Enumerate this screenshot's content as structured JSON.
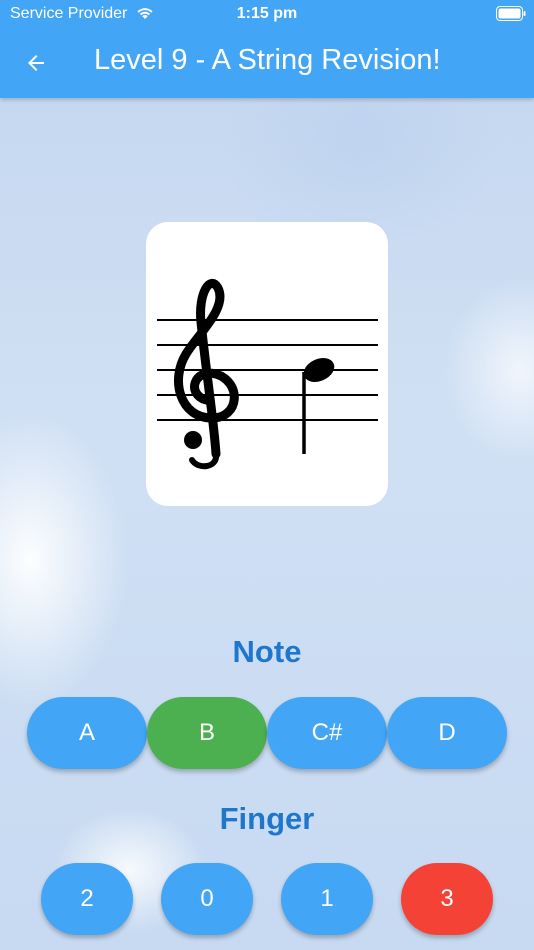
{
  "status_bar": {
    "carrier": "Service Provider",
    "time": "1:15 pm"
  },
  "header": {
    "title": "Level 9 - A String Revision!",
    "back_icon": "arrow-back-icon",
    "background": "#42a5f5"
  },
  "note_card": {
    "clef": "treble-clef",
    "note": "quarter note"
  },
  "note_section": {
    "label": "Note",
    "options": [
      "A",
      "B",
      "C#",
      "D"
    ],
    "selected_correct": "B"
  },
  "finger_section": {
    "label": "Finger",
    "options": [
      "2",
      "0",
      "1",
      "3"
    ],
    "selected_wrong": "3"
  },
  "colors": {
    "accent": "#42a5f5",
    "label": "#1e77cc",
    "correct": "#4caf50",
    "wrong": "#f44336"
  }
}
